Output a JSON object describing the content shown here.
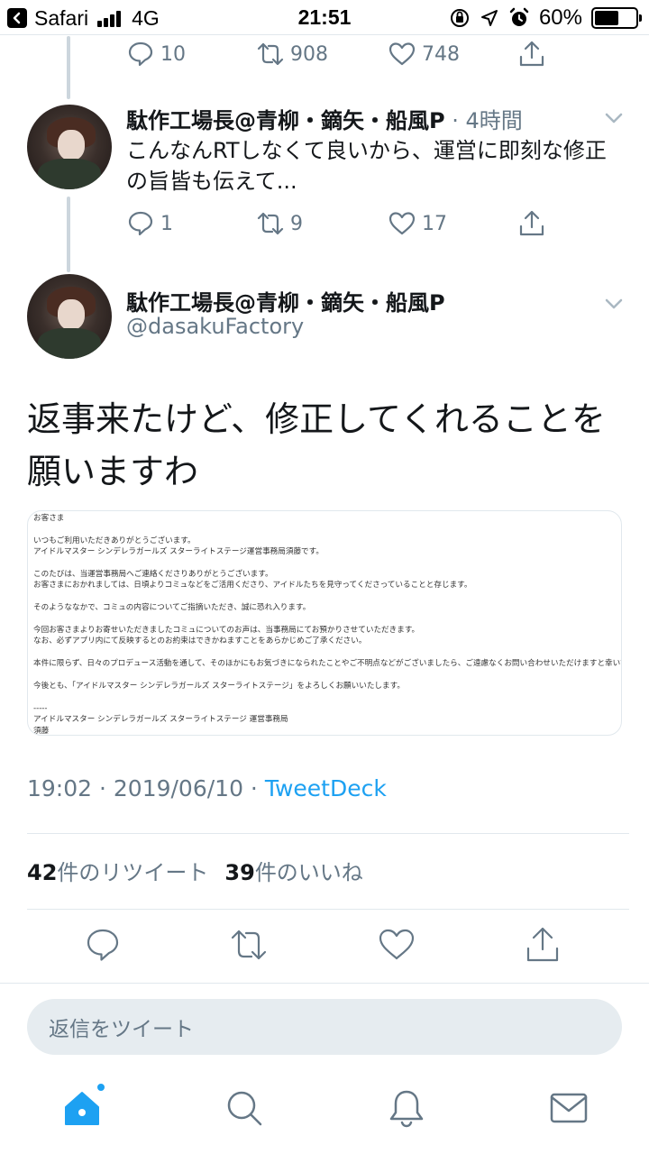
{
  "status_bar": {
    "app": "Safari",
    "network": "4G",
    "time": "21:51",
    "battery": "60%",
    "battery_level": 0.6
  },
  "prev_tweet_actions": {
    "replies": "10",
    "retweets": "908",
    "likes": "748"
  },
  "reply_tweet": {
    "name": "駄作工場長@青柳・鏑矢・船風P",
    "meta": " · 4時間",
    "text": "こんなんRTしなくて良いから、運営に即刻な修正の旨皆も伝えて...",
    "replies": "1",
    "retweets": "9",
    "likes": "17"
  },
  "main_tweet": {
    "name": "駄作工場長@青柳・鏑矢・船風P",
    "handle": "@dasakuFactory",
    "text": "返事来たけど、修正してくれることを願いますわ",
    "timestamp": "19:02 · 2019/06/10 · ",
    "source": "TweetDeck",
    "retweet_count": "42",
    "retweet_label": "件のリツイート",
    "like_count": "39",
    "like_label": "件のいいね"
  },
  "media_letter": {
    "lines": [
      "お客さま",
      "",
      "いつもご利用いただきありがとうございます。",
      "アイドルマスター シンデレラガールズ スターライトステージ運営事務局須藤です。",
      "",
      "このたびは、当運営事務局へご連絡くださりありがとうございます。",
      "お客さまにおかれましては、日頃よりコミュなどをご活用くださり、アイドルたちを見守ってくださっていることと存じます。",
      "",
      "そのようななかで、コミュの内容についてご指摘いただき、誠に恐れ入ります。",
      "",
      "今回お客さまよりお寄せいただきましたコミュについてのお声は、当事務局にてお預かりさせていただきます。",
      "なお、必ずアプリ内にて反映するとのお約束はできかねますことをあらかじめご了承ください。",
      "",
      "本件に限らず、日々のプロデュース活動を通して、そのほかにもお気づきになられたことやご不明点などがございましたら、ご遠慮なくお問い合わせいただけますと幸いです。",
      "",
      "今後とも、「アイドルマスター シンデレラガールズ スターライトステージ」をよろしくお願いいたします。",
      "",
      "-----",
      "アイドルマスター シンデレラガールズ スターライトステージ 運営事務局",
      "須藤"
    ]
  },
  "reply_input": {
    "placeholder": "返信をツイート"
  },
  "colors": {
    "accent": "#1da1f2",
    "secondary_text": "#657786",
    "primary_text": "#14171a",
    "divider": "#e1e8ed"
  },
  "icons": {
    "reply": "reply-icon",
    "retweet": "retweet-icon",
    "like": "heart-icon",
    "share": "share-icon",
    "home": "home-icon",
    "search": "search-icon",
    "notifications": "bell-icon",
    "messages": "mail-icon"
  }
}
